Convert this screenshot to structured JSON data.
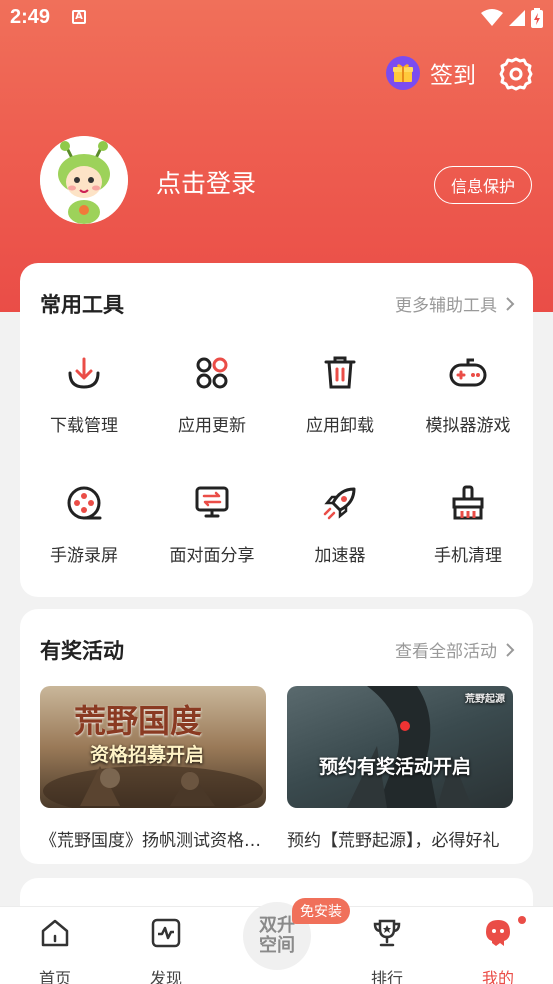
{
  "status": {
    "time": "2:49"
  },
  "header": {
    "signin_label": "签到",
    "login_label": "点击登录",
    "privacy_label": "信息保护"
  },
  "tools": {
    "title": "常用工具",
    "more": "更多辅助工具",
    "items": [
      {
        "label": "下载管理",
        "icon": "download-icon"
      },
      {
        "label": "应用更新",
        "icon": "app-update-icon"
      },
      {
        "label": "应用卸载",
        "icon": "trash-icon"
      },
      {
        "label": "模拟器游戏",
        "icon": "gamepad-icon"
      },
      {
        "label": "手游录屏",
        "icon": "record-icon"
      },
      {
        "label": "面对面分享",
        "icon": "share-icon"
      },
      {
        "label": "加速器",
        "icon": "rocket-icon"
      },
      {
        "label": "手机清理",
        "icon": "broom-icon"
      }
    ]
  },
  "events": {
    "title": "有奖活动",
    "more": "查看全部活动",
    "items": [
      {
        "caption": "《荒野国度》扬帆测试资格招募开启",
        "banner_title": "荒野国度",
        "banner_sub": "资格招募开启"
      },
      {
        "caption": "预约【荒野起源】，必得好礼",
        "banner_title": "预约有奖活动开启",
        "banner_logo": "荒野起源"
      }
    ]
  },
  "tabbar": {
    "items": [
      {
        "label": "首页",
        "icon": "home-icon"
      },
      {
        "label": "发现",
        "icon": "discover-icon"
      },
      {
        "label": "排行",
        "icon": "trophy-icon"
      },
      {
        "label": "我的",
        "icon": "mine-icon"
      }
    ],
    "center_label_1": "双升",
    "center_label_2": "空间",
    "install_badge": "免安装"
  },
  "colors": {
    "accent": "#ea4d47",
    "hero_top": "#f0705a"
  }
}
